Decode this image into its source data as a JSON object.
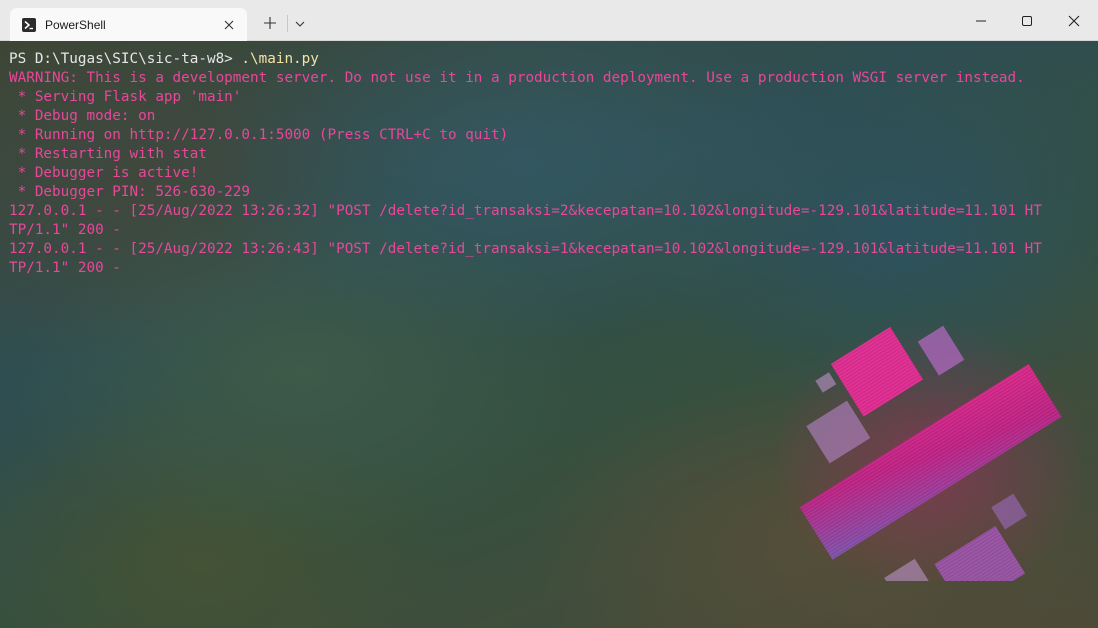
{
  "window": {
    "tab_title": "PowerShell",
    "tab_icon": "powershell-icon",
    "new_tab_icon": "plus-icon",
    "dropdown_icon": "chevron-down-icon",
    "controls": [
      "minimize-icon",
      "maximize-icon",
      "close-icon"
    ]
  },
  "terminal": {
    "prompt": "PS D:\\Tugas\\SIC\\sic-ta-w8> ",
    "command": ".\\main.py",
    "output_color": "#e8479a",
    "lines": [
      "WARNING: This is a development server. Do not use it in a production deployment. Use a production WSGI server instead.",
      " * Serving Flask app 'main'",
      " * Debug mode: on",
      " * Running on http://127.0.0.1:5000 (Press CTRL+C to quit)",
      " * Restarting with stat",
      " * Debugger is active!",
      " * Debugger PIN: 526-630-229",
      "127.0.0.1 - - [25/Aug/2022 13:26:32] \"POST /delete?id_transaksi=2&kecepatan=10.102&longitude=-129.101&latitude=11.101 HT",
      "TP/1.1\" 200 -",
      "127.0.0.1 - - [25/Aug/2022 13:26:43] \"POST /delete?id_transaksi=1&kecepatan=10.102&longitude=-129.101&latitude=11.101 HT",
      "TP/1.1\" 200 -"
    ]
  }
}
